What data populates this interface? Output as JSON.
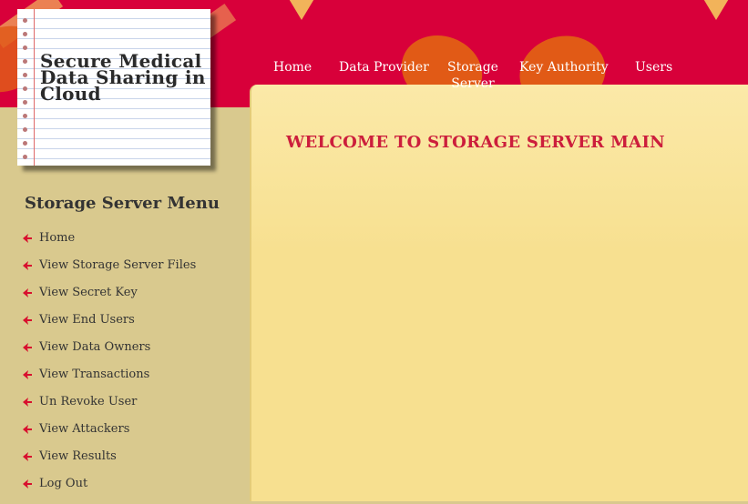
{
  "logo": {
    "title": "Secure Medical Data Sharing in Cloud"
  },
  "nav": {
    "items": [
      {
        "label": "Home"
      },
      {
        "label": "Data Provider"
      },
      {
        "label": "Storage Server"
      },
      {
        "label": "Key Authority"
      },
      {
        "label": "Users"
      }
    ]
  },
  "sidebar": {
    "title": "Storage Server Menu",
    "items": [
      {
        "label": "Home"
      },
      {
        "label": "View Storage Server Files"
      },
      {
        "label": "View Secret Key"
      },
      {
        "label": "View End Users"
      },
      {
        "label": "View Data Owners"
      },
      {
        "label": "View Transactions"
      },
      {
        "label": "Un Revoke User"
      },
      {
        "label": "View Attackers"
      },
      {
        "label": "View Results"
      },
      {
        "label": "Log Out"
      }
    ]
  },
  "main": {
    "title": "WELCOME TO STORAGE SERVER MAIN"
  },
  "colors": {
    "header": "#d8003a",
    "sidebar": "#d9c98e",
    "content": "#f7e090",
    "accent": "#cc1e3c"
  },
  "icons": {
    "menu_bullet": "arrow-bullet-icon"
  }
}
